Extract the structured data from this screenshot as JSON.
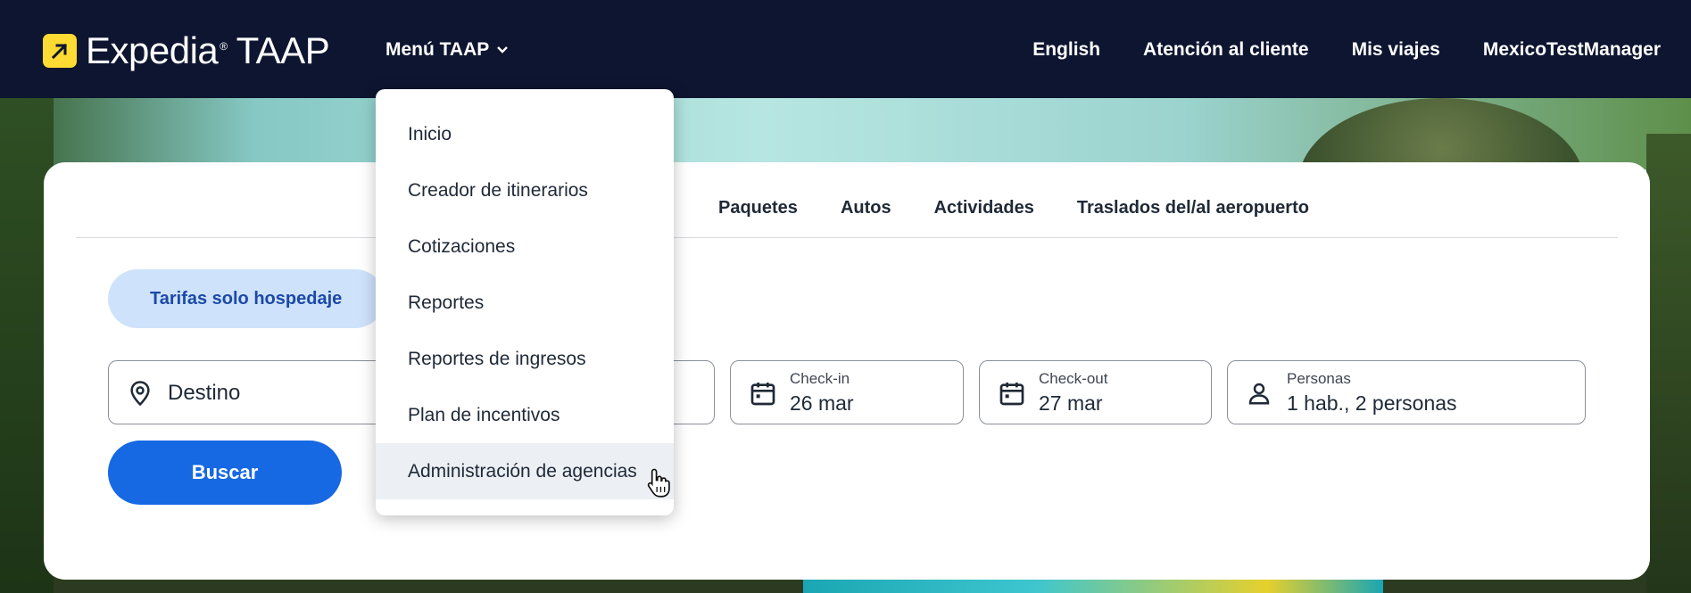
{
  "header": {
    "brand": "Expedia",
    "brand_suffix": "TAAP",
    "menu_label": "Menú TAAP",
    "nav": [
      "English",
      "Atención al cliente",
      "Mis viajes",
      "MexicoTestManager"
    ]
  },
  "tabs": [
    "Paquetes",
    "Autos",
    "Actividades",
    "Traslados del/al aeropuerto"
  ],
  "filter_pill": "Tarifas solo hospedaje",
  "search": {
    "destination_placeholder": "Destino",
    "checkin_label": "Check-in",
    "checkin_value": "26 mar",
    "checkout_label": "Check-out",
    "checkout_value": "27 mar",
    "travelers_label": "Personas",
    "travelers_value": "1 hab., 2 personas",
    "button": "Buscar"
  },
  "dropdown": {
    "items": [
      "Inicio",
      "Creador de itinerarios",
      "Cotizaciones",
      "Reportes",
      "Reportes de ingresos",
      "Plan de incentivos",
      "Administración de agencias"
    ],
    "hovered": "Administración de agencias"
  },
  "colors": {
    "header_bg": "#0d1530",
    "brand_yellow": "#fddb32",
    "primary_blue": "#1668e3",
    "pill_bg": "#cfe2fb",
    "pill_text": "#1b4aa6"
  }
}
